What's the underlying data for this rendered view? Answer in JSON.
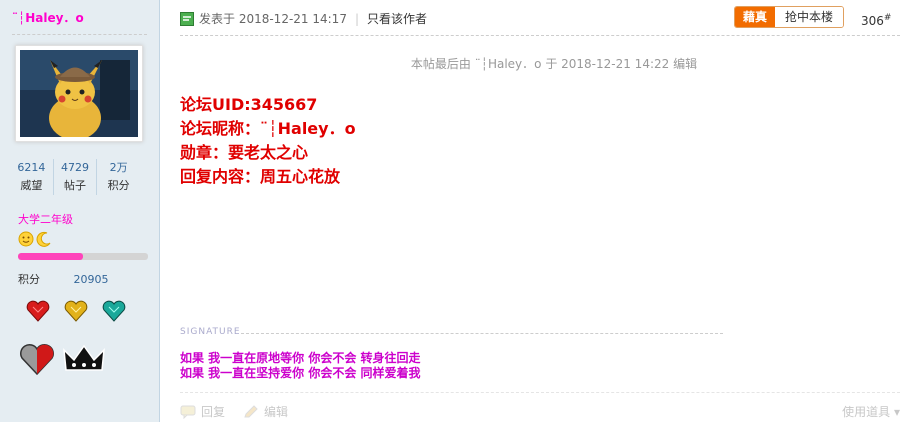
{
  "sidebar": {
    "username": "¨┆Haley．o",
    "stats": [
      {
        "value": "6214",
        "label": "威望"
      },
      {
        "value": "4729",
        "label": "帖子"
      },
      {
        "value": "2万",
        "label": "积分"
      }
    ],
    "level": "大学二年级",
    "level_progress": 0.5,
    "credits_label": "积分",
    "credits_value": "20905"
  },
  "post": {
    "posted_at": "发表于 2018-12-21 14:17",
    "author_only": "只看该作者",
    "hot_label": "藉真",
    "grab_label": "抢中本楼",
    "floor": "306",
    "floor_mark": "#",
    "edited_note": "本帖最后由 ¨┆Haley．o 于 2018-12-21 14:22 编辑",
    "content_lines": [
      "论坛UID:345667",
      "论坛昵称：¨┆Haley．o",
      "勋章：要老太之心",
      "回复内容：周五心花放"
    ],
    "signature_label": "SIGNATURE",
    "signature_lines": [
      "如果 我一直在原地等你 你会不会 转身往回走",
      "如果 我一直在坚持爱你 你会不会 同样爱着我"
    ],
    "reply_label": "回复",
    "edit_label": "编辑",
    "tools_label": "使用道具"
  },
  "colors": {
    "accent_pink": "#ff00cc",
    "content_red": "#e00000",
    "signature_magenta": "#cc00cc",
    "hot_orange": "#f26c00"
  }
}
